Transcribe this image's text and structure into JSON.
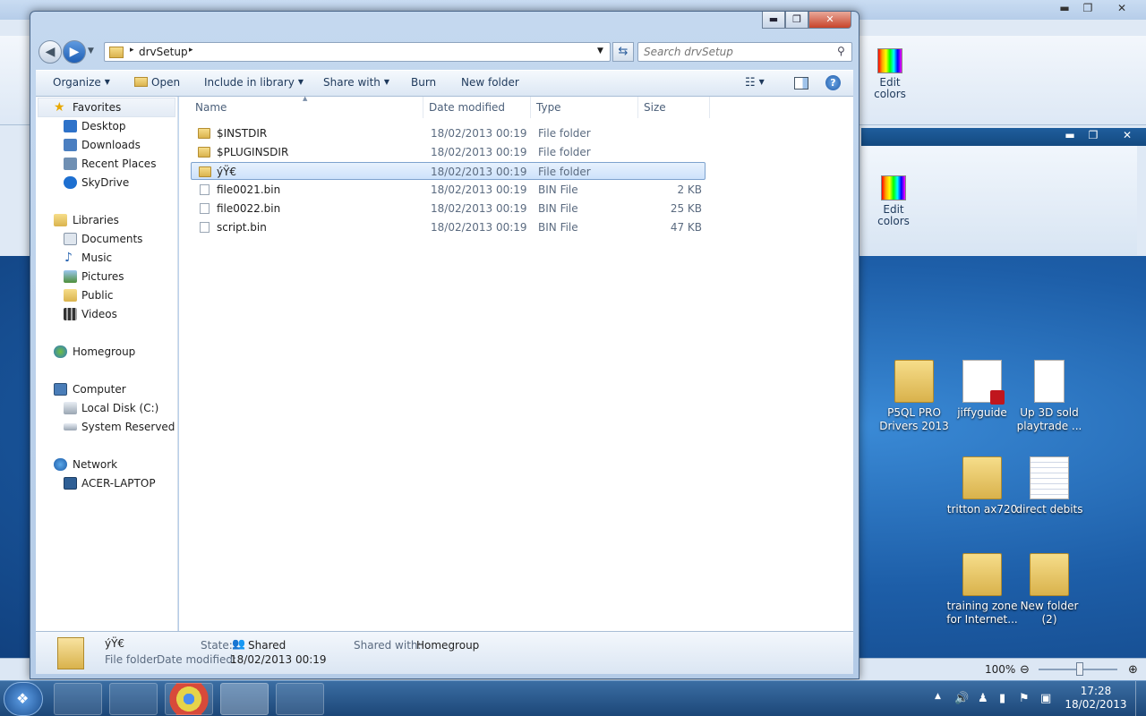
{
  "explorer": {
    "title_buttons": {
      "minimize": "▬",
      "maximize": "❐",
      "close": "✕"
    },
    "address": {
      "root_icon": "folder-icon",
      "sep1": "▸",
      "path": "drvSetup",
      "sep2": "▸"
    },
    "search_placeholder": "Search drvSetup",
    "commands": {
      "organize": "Organize",
      "open": "Open",
      "include_in_library": "Include in library",
      "share_with": "Share with",
      "burn": "Burn",
      "new_folder": "New folder"
    },
    "nav": {
      "favorites": "Favorites",
      "desktop": "Desktop",
      "downloads": "Downloads",
      "recent_places": "Recent Places",
      "skydrive": "SkyDrive",
      "libraries": "Libraries",
      "documents": "Documents",
      "music": "Music",
      "pictures": "Pictures",
      "public": "Public",
      "videos": "Videos",
      "homegroup": "Homegroup",
      "computer": "Computer",
      "local_disk": "Local Disk (C:)",
      "system_reserved": "System Reserved (E:)",
      "network": "Network",
      "acer_laptop": "ACER-LAPTOP"
    },
    "columns": {
      "name": "Name",
      "date_modified": "Date modified",
      "type": "Type",
      "size": "Size"
    },
    "files": [
      {
        "name": "$INSTDIR",
        "date": "18/02/2013 00:19",
        "type": "File folder",
        "size": ""
      },
      {
        "name": "$PLUGINSDIR",
        "date": "18/02/2013 00:19",
        "type": "File folder",
        "size": ""
      },
      {
        "name": "ýŸ€",
        "date": "18/02/2013 00:19",
        "type": "File folder",
        "size": ""
      },
      {
        "name": "file0021.bin",
        "date": "18/02/2013 00:19",
        "type": "BIN File",
        "size": "2 KB"
      },
      {
        "name": "file0022.bin",
        "date": "18/02/2013 00:19",
        "type": "BIN File",
        "size": "25 KB"
      },
      {
        "name": "script.bin",
        "date": "18/02/2013 00:19",
        "type": "BIN File",
        "size": "47 KB"
      }
    ],
    "details": {
      "name": "ýŸ€",
      "type": "File folder",
      "date_label": "Date modified:",
      "date_value": "18/02/2013 00:19",
      "state_label": "State:",
      "state_value": "Shared",
      "shared_label": "Shared with:",
      "shared_value": "Homegroup"
    }
  },
  "paint": {
    "edit_colors_1": "Edit colors",
    "edit_colors_2": "Edit colors",
    "zoom": "100%"
  },
  "desktop_icons": [
    {
      "label": "P5QL PRO Drivers 2013",
      "icon": "folder-icon"
    },
    {
      "label": "jiffyguide",
      "icon": "pdf-icon"
    },
    {
      "label": "Up 3D sold playtrade ...",
      "icon": "document-icon"
    },
    {
      "label": "tritton ax720",
      "icon": "folder-icon"
    },
    {
      "label": "direct debits",
      "icon": "spreadsheet-icon"
    },
    {
      "label": "training zone for Internet...",
      "icon": "folder-icon"
    },
    {
      "label": "New folder (2)",
      "icon": "folder-icon"
    }
  ],
  "taskbar": {
    "time": "17:28",
    "date": "18/02/2013",
    "apps": [
      "media-player-icon",
      "explorer-icon",
      "chrome-icon",
      "libraries-icon",
      "paint-icon"
    ]
  }
}
